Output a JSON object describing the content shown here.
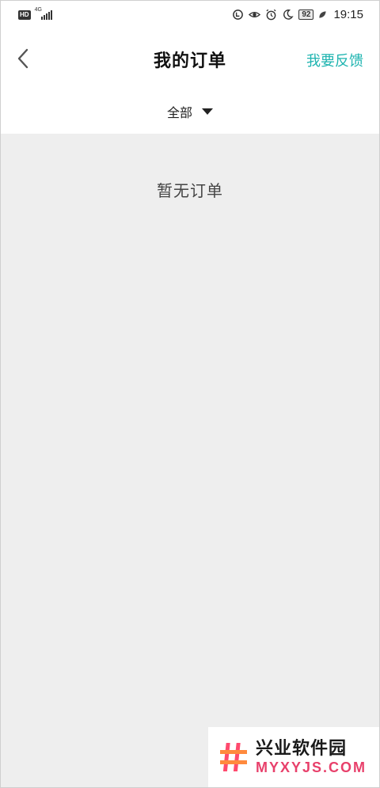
{
  "status_bar": {
    "hd_label": "HD",
    "network_label": "4G",
    "battery_level": "92",
    "time": "19:15"
  },
  "nav": {
    "title": "我的订单",
    "feedback_label": "我要反馈"
  },
  "filter": {
    "selected": "全部"
  },
  "content": {
    "empty_message": "暂无订单"
  },
  "watermark": {
    "cn_text": "兴业软件园",
    "en_text": "MYXYJS.COM"
  },
  "colors": {
    "accent": "#1fb4b0",
    "content_bg": "#eeeeee",
    "watermark_en": "#e8406b"
  }
}
